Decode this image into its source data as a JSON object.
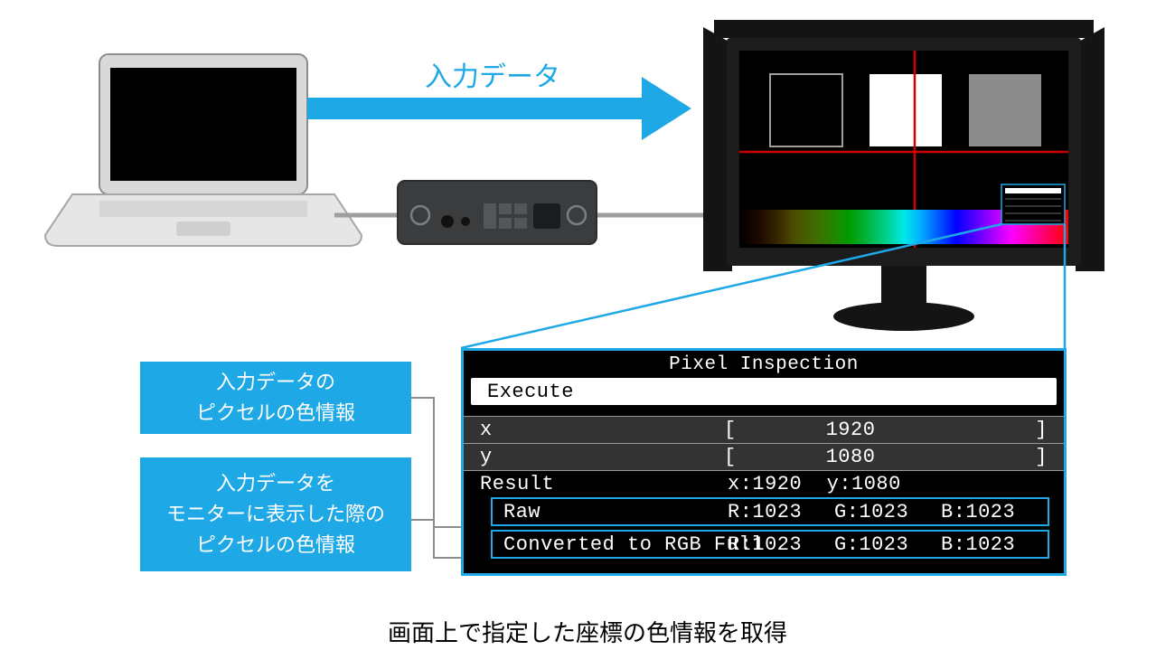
{
  "arrow": {
    "label": "入力データ"
  },
  "labels": {
    "raw_info_line1": "入力データの",
    "raw_info_line2": "ピクセルの色情報",
    "conv_info_line1": "入力データを",
    "conv_info_line2": "モニターに表示した際の",
    "conv_info_line3": "ピクセルの色情報"
  },
  "osd": {
    "title": "Pixel Inspection",
    "execute": "Execute",
    "x_label": "x",
    "y_label": "y",
    "x_value": "1920",
    "y_value": "1080",
    "result_label": "Result",
    "result_coords": "x:1920  y:1080",
    "raw_label": "Raw",
    "raw_r": "R:1023",
    "raw_g": "G:1023",
    "raw_b": "B:1023",
    "conv_label": "Converted to RGB Full",
    "conv_r": "R:1023",
    "conv_g": "G:1023",
    "conv_b": "B:1023",
    "bracket_open": "[",
    "bracket_close": "]"
  },
  "caption": "画面上で指定した座標の色情報を取得"
}
